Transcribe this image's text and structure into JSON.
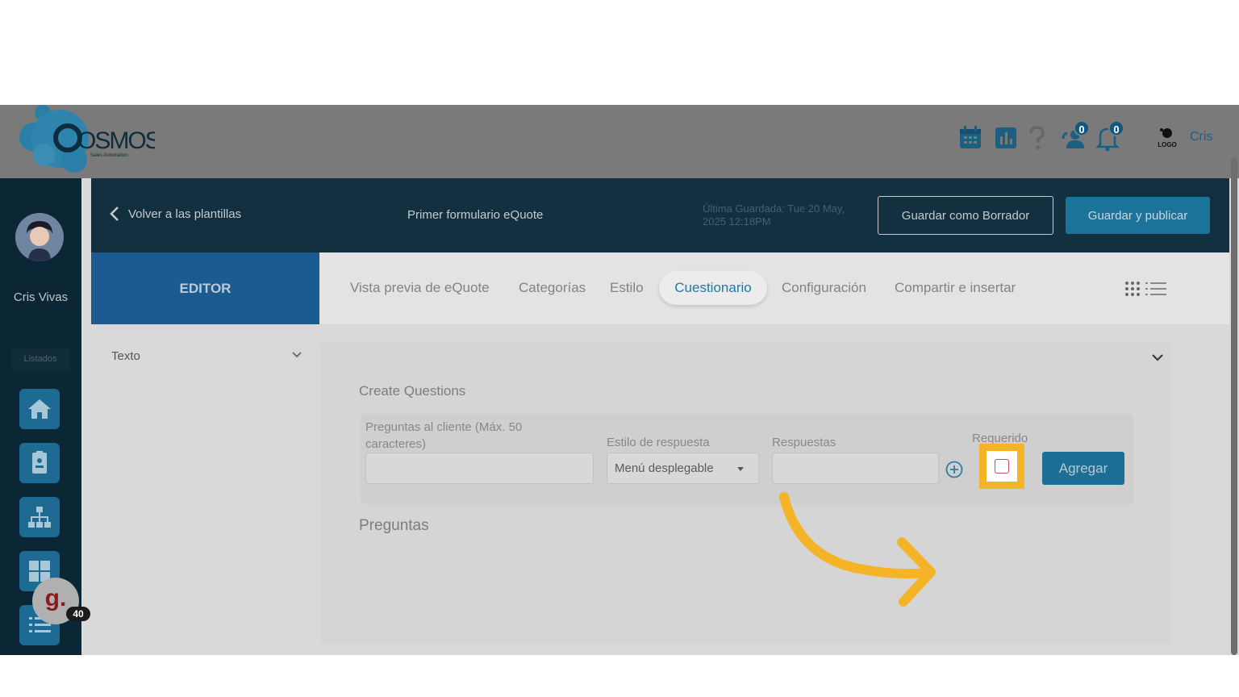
{
  "brand": {
    "name": "OSMOS",
    "tagline": "Sales Automation"
  },
  "topbar": {
    "icons": [
      "calendar-icon",
      "chart-icon",
      "help-icon",
      "user-notify-icon",
      "bell-icon"
    ],
    "user_notifications": "0",
    "bell_notifications": "0",
    "company_logo_text": "LOGO",
    "user_short": "Cris"
  },
  "rail": {
    "user_name": "Cris Vivas",
    "section_label": "Listados",
    "items": [
      "home-icon",
      "contact-card-icon",
      "org-chart-icon",
      "grid-icon",
      "list-icon"
    ],
    "widget_letter": "g.",
    "widget_count": "40"
  },
  "header": {
    "back_label": "Volver a las plantillas",
    "form_title": "Primer formulario eQuote",
    "last_saved": "Última Guardada: Tue 20 May, 2025 12:18PM",
    "draft_button": "Guardar como Borrador",
    "publish_button": "Guardar y publicar"
  },
  "tabs": {
    "editor": "EDITOR",
    "items": [
      "Vista previa de eQuote",
      "Categorías",
      "Estilo",
      "Cuestionario",
      "Configuración",
      "Compartir e insertar"
    ],
    "active": "Cuestionario"
  },
  "sidepanel": {
    "field_type": "Texto"
  },
  "form": {
    "section_title": "Create Questions",
    "question_label": "Preguntas al cliente (Máx. 50 caracteres)",
    "question_value": "",
    "style_label": "Estilo de respuesta",
    "style_value": "Menú desplegable",
    "answers_label": "Respuestas",
    "answers_value": "",
    "required_label": "Requerido",
    "required_checked": false,
    "add_button": "Agregar",
    "list_title": "Preguntas"
  },
  "colors": {
    "accent_blue": "#1c7399",
    "highlight": "#f5b428",
    "dark_header": "#12303f"
  }
}
